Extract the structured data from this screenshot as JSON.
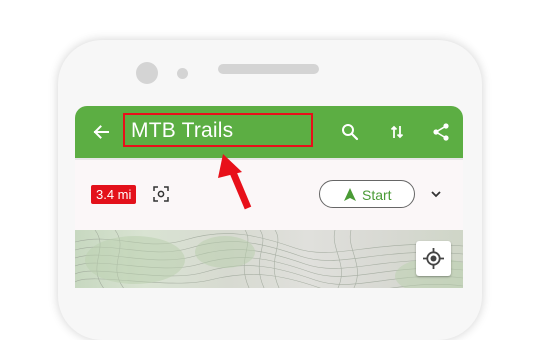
{
  "appbar": {
    "title": "MTB Trails",
    "color": "#5cae43",
    "icons": [
      "back-arrow-icon",
      "search-icon",
      "sort-icon",
      "share-icon"
    ]
  },
  "route_card": {
    "distance": "3.4 mi",
    "distance_color": "#e3111b",
    "start_label": "Start",
    "start_color": "#4a9b35",
    "icons": [
      "scan-icon",
      "navigation-arrow-icon",
      "chevron-down-icon"
    ]
  },
  "map": {
    "icons": [
      "my-location-icon"
    ]
  },
  "annotation": {
    "highlight_color": "#e8101a",
    "icons": [
      "red-pointer-arrow-icon"
    ]
  }
}
